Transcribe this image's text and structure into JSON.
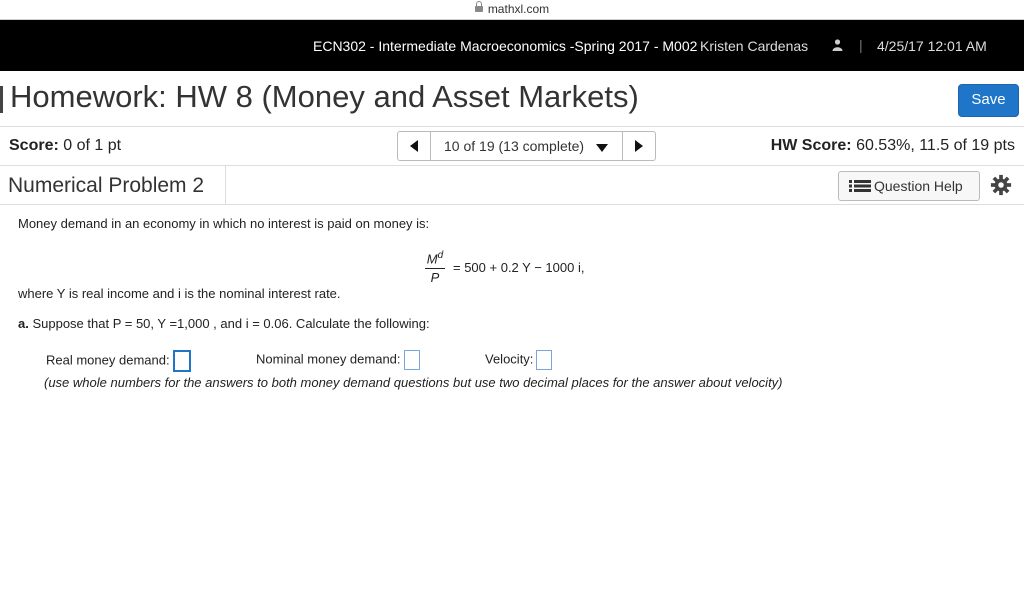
{
  "browser": {
    "url": "mathxl.com"
  },
  "course_bar": {
    "course": "ECN302 - Intermediate Macroeconomics -Spring 2017 - M002",
    "user": "Kristen Cardenas",
    "separator": "|",
    "datetime": "4/25/17 12:01 AM"
  },
  "homework": {
    "title": "Homework: HW 8 (Money and Asset Markets)",
    "save_label": "Save"
  },
  "score_bar": {
    "score_label": "Score:",
    "score_value": "0 of 1 pt",
    "position": "10 of 19 (13 complete)",
    "hw_score_label": "HW Score:",
    "hw_score_value": "60.53%, 11.5 of 19 pts"
  },
  "problem": {
    "title": "Numerical Problem 2",
    "help_label": "Question Help"
  },
  "question": {
    "intro": "Money demand in an economy in which no interest is paid on money is:",
    "eq_num": "M",
    "eq_num_sup": "d",
    "eq_den": "P",
    "eq_rhs": "=  500  +  0.2 Y  −  1000 i,",
    "where": "where Y is real income and i is the nominal interest rate.",
    "part_label": "a.",
    "part_text": "Suppose that P = 50, Y =1,000 , and i = 0.06. Calculate the following:",
    "answers": [
      {
        "label": "Real money demand:",
        "value": ""
      },
      {
        "label": "Nominal money demand:",
        "value": ""
      },
      {
        "label": "Velocity:",
        "value": ""
      }
    ],
    "instructions": "(use whole numbers for the answers to both money demand questions but use two decimal places for the answer about velocity)"
  },
  "colors": {
    "accent": "#1f75c8",
    "course_bar_bg": "#000000"
  }
}
